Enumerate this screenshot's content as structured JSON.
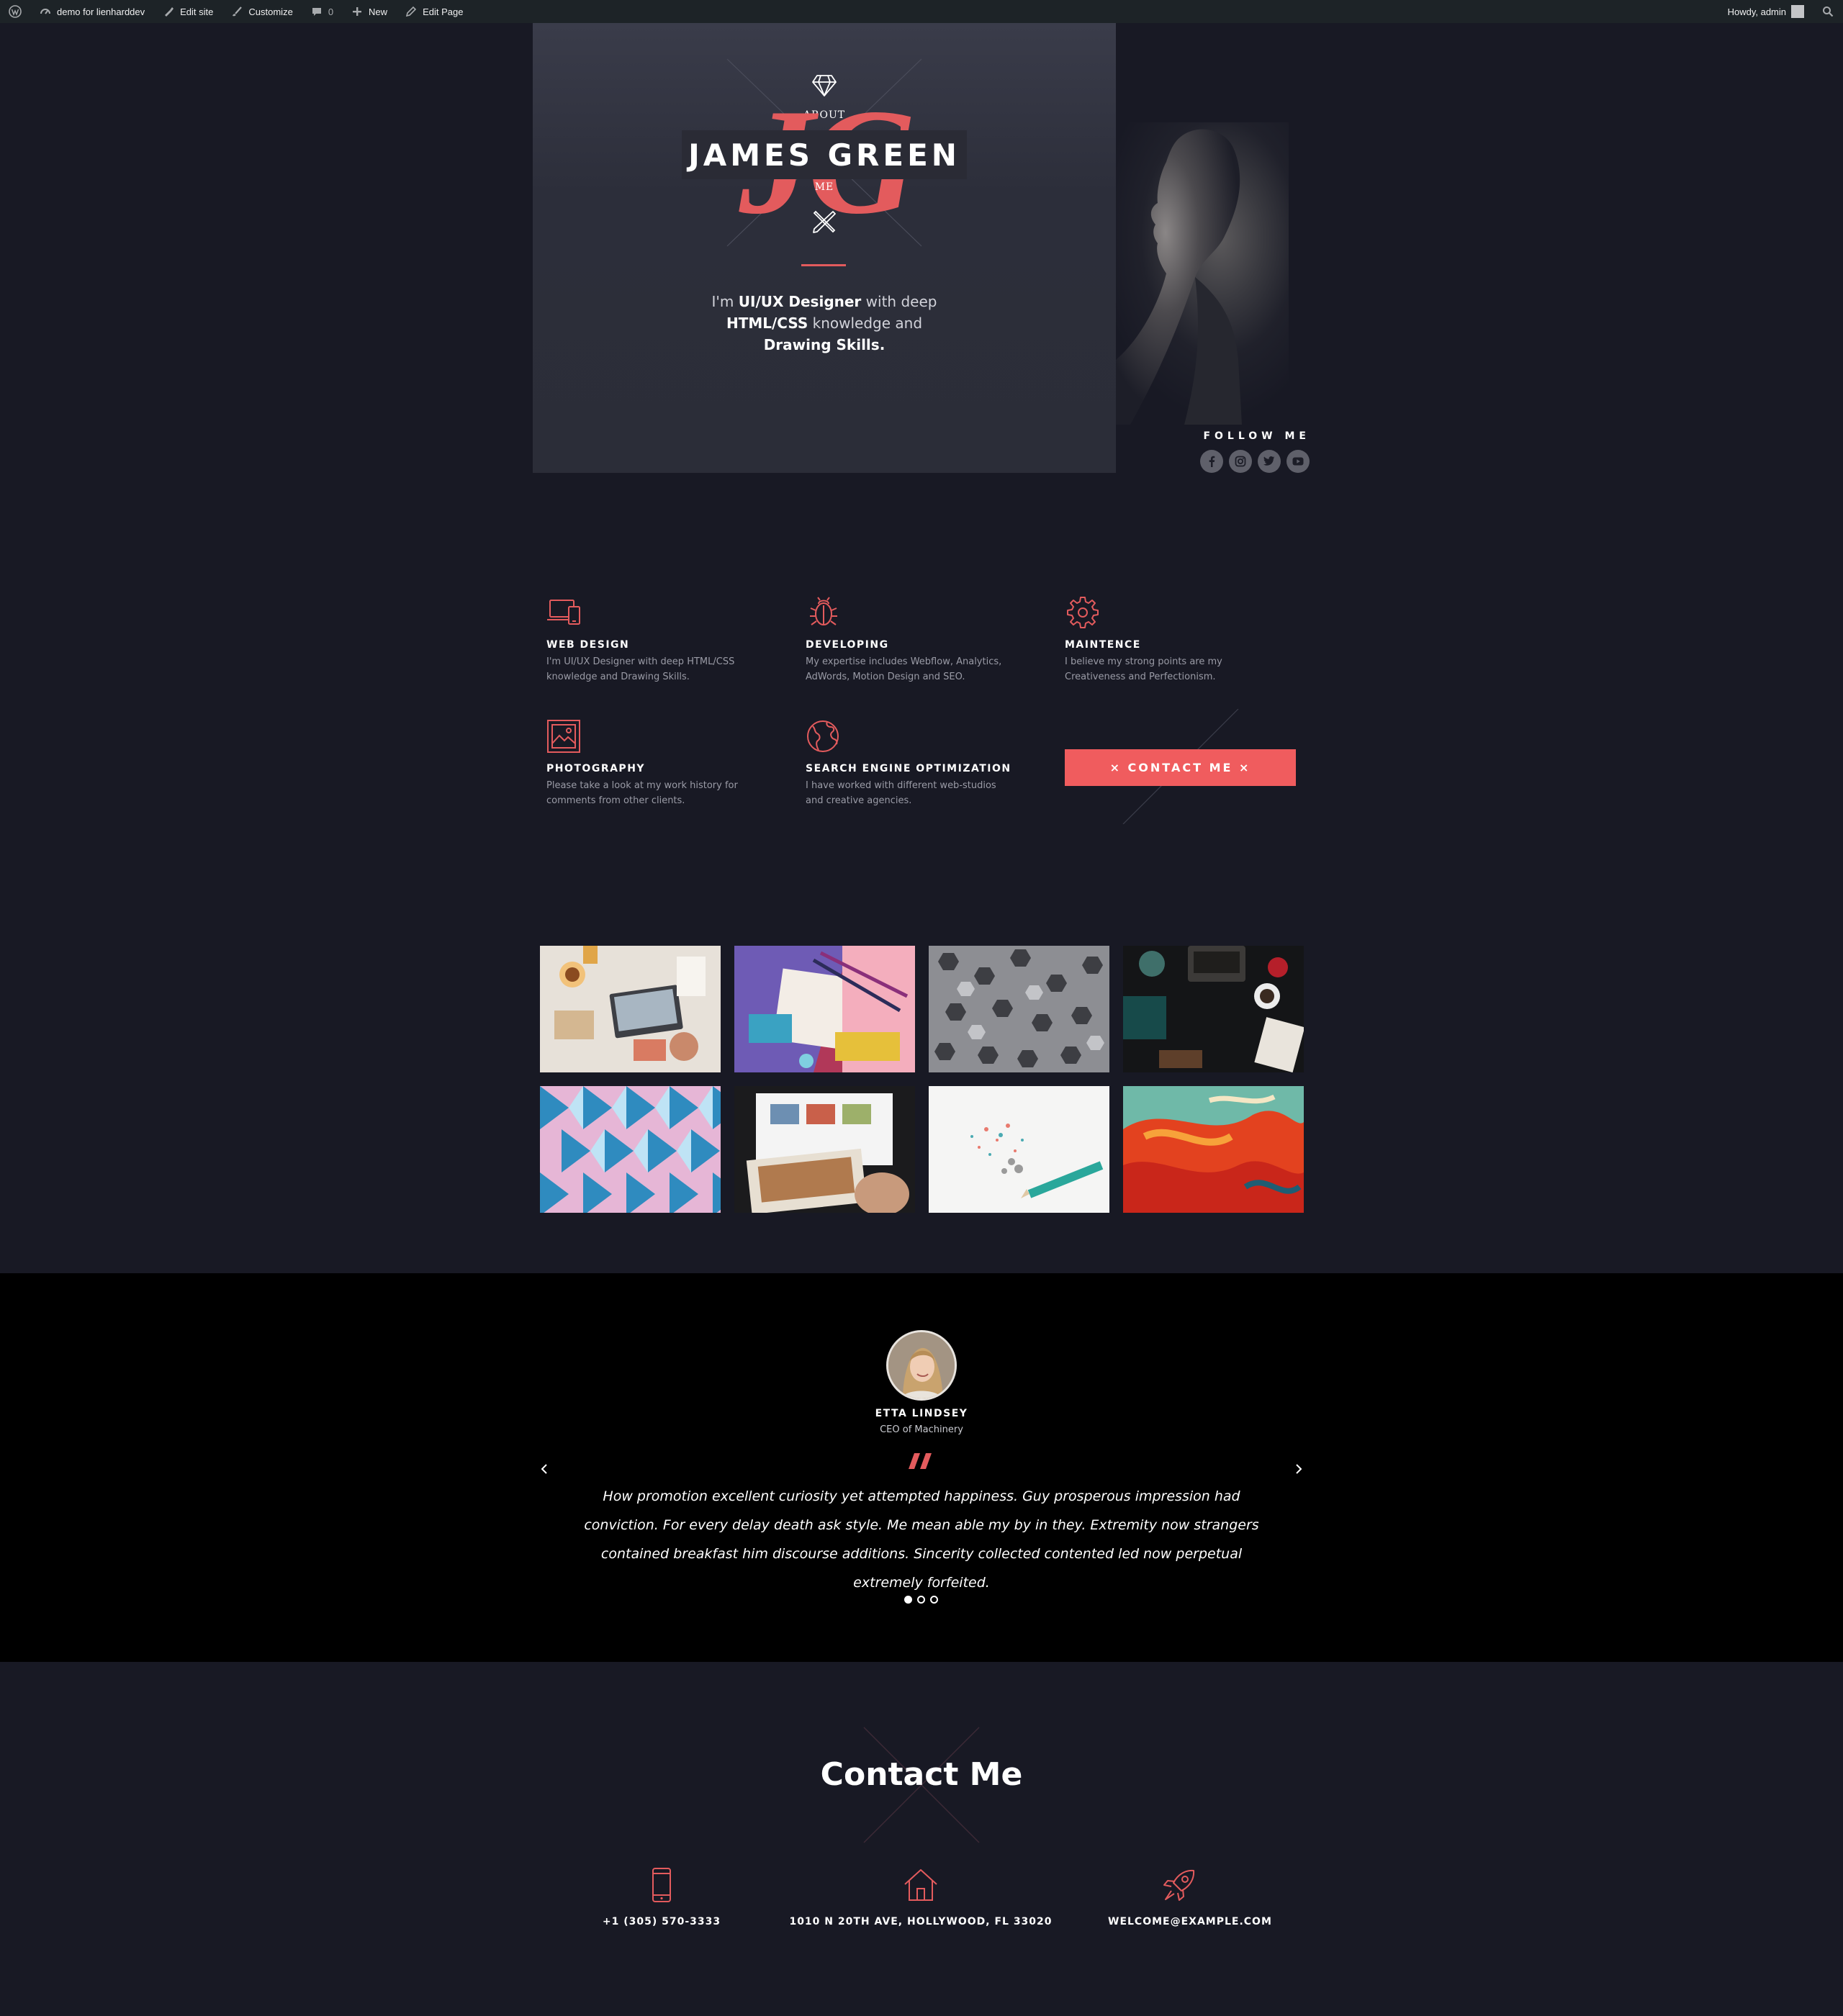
{
  "adminbar": {
    "site_name": "demo for lienharddev",
    "edit_site": "Edit site",
    "customize": "Customize",
    "comments_count": "0",
    "new": "New",
    "edit_page": "Edit Page",
    "howdy": "Howdy, admin"
  },
  "hero": {
    "about": "ABOUT",
    "monogram": "JG",
    "name": "JAMES GREEN",
    "me": "ME",
    "intro_p1": "I'm ",
    "intro_b1": "UI/UX Designer",
    "intro_p2": " with deep ",
    "intro_b2": "HTML/CSS",
    "intro_p3": " knowledge and ",
    "intro_b3": "Drawing Skills.",
    "follow": "FOLLOW ME"
  },
  "social": [
    "facebook-icon",
    "instagram-icon",
    "twitter-icon",
    "youtube-icon"
  ],
  "services": [
    {
      "icon": "devices-icon",
      "title": "WEB DESIGN",
      "desc": "I'm UI/UX Designer with deep HTML/CSS knowledge and Drawing Skills."
    },
    {
      "icon": "bug-icon",
      "title": "DEVELOPING",
      "desc": "My expertise includes Webflow, Analytics, AdWords, Motion Design and SEO."
    },
    {
      "icon": "gear-icon",
      "title": "MAINTENCE",
      "desc": "I believe my strong points are my Creativeness and Perfectionism."
    },
    {
      "icon": "image-icon",
      "title": "PHOTOGRAPHY",
      "desc": "Please take a look at my work history for comments from other clients."
    },
    {
      "icon": "globe-icon",
      "title": "SEARCH ENGINE OPTIMIZATION",
      "desc": "I have worked with different web-studios and creative agencies."
    }
  ],
  "cta": {
    "label": "× CONTACT ME ×"
  },
  "testimonial": {
    "name": "ETTA LINDSEY",
    "role": "CEO of Machinery",
    "quote": "How promotion excellent curiosity yet attempted happiness. Guy prosperous impression had conviction. For every delay death ask style. Me mean able my by in they. Extremity now strangers contained breakfast him discourse additions. Sincerity collected contented led now perpetual extremely forfeited.",
    "active_slide": 1,
    "slides": 3
  },
  "contact": {
    "title": "Contact Me",
    "phone": "+1 (305) 570-3333",
    "address": "1010 N 20TH AVE, HOLLYWOOD, FL 33020",
    "email": "WELCOME@EXAMPLE.COM"
  },
  "colors": {
    "accent": "#f05c5e",
    "background": "#181924",
    "testimonial_bg": "#000000"
  }
}
